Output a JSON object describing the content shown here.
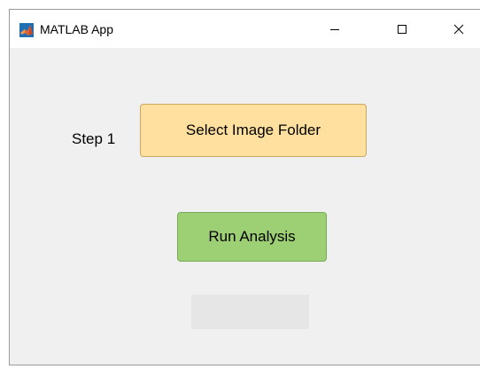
{
  "window": {
    "title": "MATLAB App",
    "icon": "matlab-logo-icon",
    "controls": {
      "minimize_icon": "minimize-icon",
      "maximize_icon": "maximize-icon",
      "close_icon": "close-icon"
    }
  },
  "main": {
    "step_label": "Step 1",
    "select_button_label": "Select Image Folder",
    "run_button_label": "Run Analysis",
    "status_text": ""
  },
  "colors": {
    "select_button_bg": "#ffe09e",
    "run_button_bg": "#9dd074",
    "status_box_bg": "#e6e6e6",
    "window_bg": "#f0f0f0"
  }
}
